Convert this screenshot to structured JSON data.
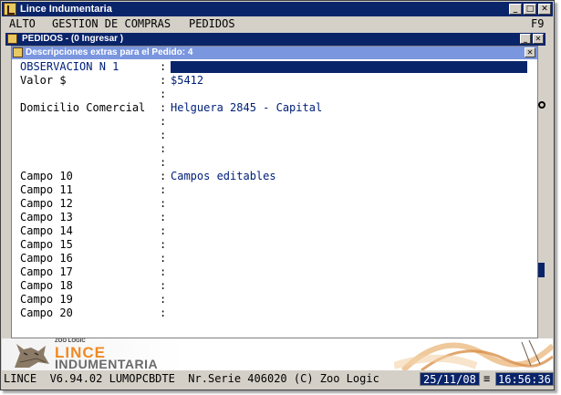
{
  "window": {
    "title": "Lince Indumentaria",
    "minimize": "_",
    "maximize": "□",
    "close": "✕"
  },
  "menu": {
    "items": [
      "ALTO",
      "GESTION DE COMPRAS",
      "PEDIDOS"
    ],
    "shortcut": "F9"
  },
  "subwindow": {
    "title": "PEDIDOS - (0  Ingresar )",
    "minimize": "_",
    "close": "✕"
  },
  "dialog": {
    "title": "Descripciones extras para el Pedido: 4",
    "close": "✕",
    "rows": [
      {
        "label": "OBSERVACION N 1",
        "colon": ":",
        "value": ""
      },
      {
        "label": "Valor $",
        "colon": ":",
        "value": "$5412"
      },
      {
        "label": "",
        "colon": ":",
        "value": ""
      },
      {
        "label": "Domicilio Comercial",
        "colon": ":",
        "value": "Helguera 2845 - Capital"
      },
      {
        "label": "",
        "colon": ":",
        "value": ""
      },
      {
        "label": "",
        "colon": ":",
        "value": ""
      },
      {
        "label": "",
        "colon": ":",
        "value": ""
      },
      {
        "label": "",
        "colon": ":",
        "value": ""
      },
      {
        "label": "Campo 10",
        "colon": ":",
        "value": "Campos editables"
      },
      {
        "label": "Campo 11",
        "colon": ":",
        "value": ""
      },
      {
        "label": "Campo 12",
        "colon": ":",
        "value": ""
      },
      {
        "label": "Campo 13",
        "colon": ":",
        "value": ""
      },
      {
        "label": "Campo 14",
        "colon": ":",
        "value": ""
      },
      {
        "label": "Campo 15",
        "colon": ":",
        "value": ""
      },
      {
        "label": "Campo 16",
        "colon": ":",
        "value": ""
      },
      {
        "label": "Campo 17",
        "colon": ":",
        "value": ""
      },
      {
        "label": "Campo 18",
        "colon": ":",
        "value": ""
      },
      {
        "label": "Campo 19",
        "colon": ":",
        "value": ""
      },
      {
        "label": "Campo 20",
        "colon": ":",
        "value": ""
      }
    ]
  },
  "banner": {
    "zoo": "ZOO LOGIC",
    "lince": "LINCE",
    "indumentaria": "INDUMENTARIA"
  },
  "status": {
    "text": "LINCE  V6.94.02 LUMOPCBDTE  Nr.Serie 406020 (C) Zoo Logic",
    "date": "25/11/08",
    "separator": "≡",
    "time": "16:56:36"
  },
  "colors": {
    "titlebar": "#0a246a",
    "dialog_titlebar": "#7a96df",
    "value_text": "#00207a",
    "brand_orange": "#f08a24"
  }
}
